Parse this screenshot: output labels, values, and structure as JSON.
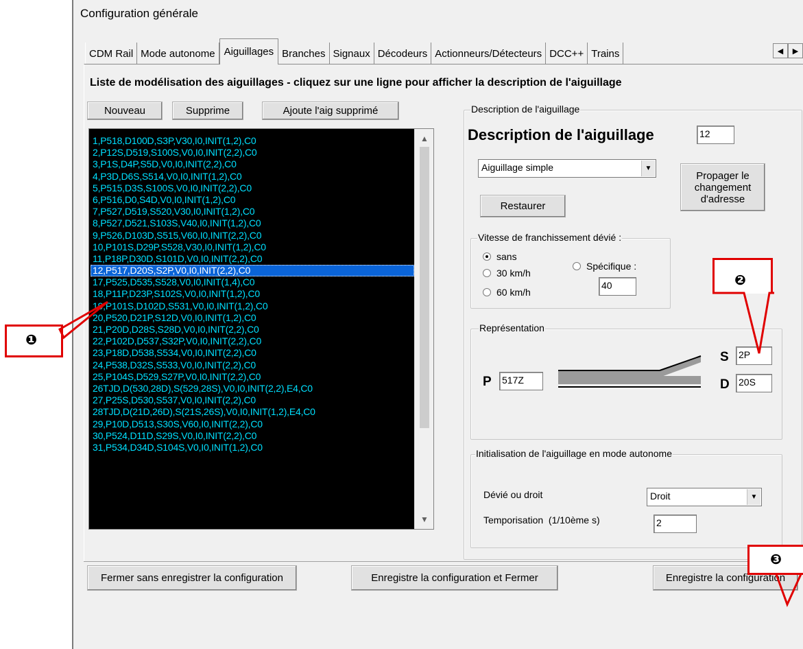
{
  "window": {
    "title": "Configuration générale"
  },
  "tabs": [
    "CDM Rail",
    "Mode autonome",
    "Aiguillages",
    "Branches",
    "Signaux",
    "Décodeurs",
    "Actionneurs/Détecteurs",
    "DCC++",
    "Trains"
  ],
  "tab_scroll": {
    "left": "◀",
    "right": "▶"
  },
  "heading": "Liste de modélisation des aiguillages - cliquez sur une ligne pour afficher la description de l'aiguillage",
  "buttons": {
    "new": "Nouveau",
    "delete": "Supprime",
    "add_deleted": "Ajoute l'aig supprimé"
  },
  "list": {
    "selected_index": 11,
    "items": [
      "1,P518,D100D,S3P,V30,I0,INIT(1,2),C0",
      "2,P12S,D519,S100S,V0,I0,INIT(2,2),C0",
      "3,P1S,D4P,S5D,V0,I0,INIT(2,2),C0",
      "4,P3D,D6S,S514,V0,I0,INIT(1,2),C0",
      "5,P515,D3S,S100S,V0,I0,INIT(2,2),C0",
      "6,P516,D0,S4D,V0,I0,INIT(1,2),C0",
      "7,P527,D519,S520,V30,I0,INIT(1,2),C0",
      "8,P527,D521,S103S,V40,I0,INIT(1,2),C0",
      "9,P526,D103D,S515,V60,I0,INIT(2,2),C0",
      "10,P101S,D29P,S528,V30,I0,INIT(1,2),C0",
      "11,P18P,D30D,S101D,V0,I0,INIT(2,2),C0",
      "12,P517,D20S,S2P,V0,I0,INIT(2,2),C0",
      "17,P525,D535,S528,V0,I0,INIT(1,4),C0",
      "18,P11P,D23P,S102S,V0,I0,INIT(1,2),C0",
      "19,P101S,D102D,S531,V0,I0,INIT(1,2),C0",
      "20,P520,D21P,S12D,V0,I0,INIT(1,2),C0",
      "21,P20D,D28S,S28D,V0,I0,INIT(2,2),C0",
      "22,P102D,D537,S32P,V0,I0,INIT(2,2),C0",
      "23,P18D,D538,S534,V0,I0,INIT(2,2),C0",
      "24,P538,D32S,S533,V0,I0,INIT(2,2),C0",
      "25,P104S,D529,S27P,V0,I0,INIT(2,2),C0",
      "26TJD,D(530,28D),S(529,28S),V0,I0,INIT(2,2),E4,C0",
      "27,P25S,D530,S537,V0,I0,INIT(2,2),C0",
      "28TJD,D(21D,26D),S(21S,26S),V0,I0,INIT(1,2),E4,C0",
      "29,P10D,D513,S30S,V60,I0,INIT(2,2),C0",
      "30,P524,D11D,S29S,V0,I0,INIT(2,2),C0",
      "31,P534,D34D,S104S,V0,I0,INIT(1,2),C0"
    ]
  },
  "description": {
    "group_label": "Description de l'aiguillage",
    "title": "Description de l'aiguillage",
    "number": "12",
    "type": "Aiguillage simple",
    "restore": "Restaurer",
    "propagate": "Propager le changement d'adresse",
    "speed_group": "Vitesse de franchissement dévié :",
    "speed_none": "sans",
    "speed_30": "30 km/h",
    "speed_60": "60 km/h",
    "speed_specific": "Spécifique :",
    "speed_specific_value": "40",
    "speed_selected": "sans"
  },
  "representation": {
    "label": "Représentation",
    "p_letter": "P",
    "p_value": "517Z",
    "s_letter": "S",
    "s_value": "2P",
    "d_letter": "D",
    "d_value": "20S"
  },
  "init": {
    "label": "Initialisation de l'aiguillage en mode autonome",
    "deviated_label": "Dévié ou droit",
    "deviated_value": "Droit",
    "delay_label": "Temporisation  (1/10ème s)",
    "delay_value": "2"
  },
  "footer": {
    "close_no_save": "Fermer sans enregistrer la configuration",
    "save_close": "Enregistre la configuration et Fermer",
    "save": "Enregistre la configuration"
  },
  "annotations": {
    "m1": "❶",
    "m2": "❷",
    "m3": "❸",
    "color": "#e00000"
  }
}
